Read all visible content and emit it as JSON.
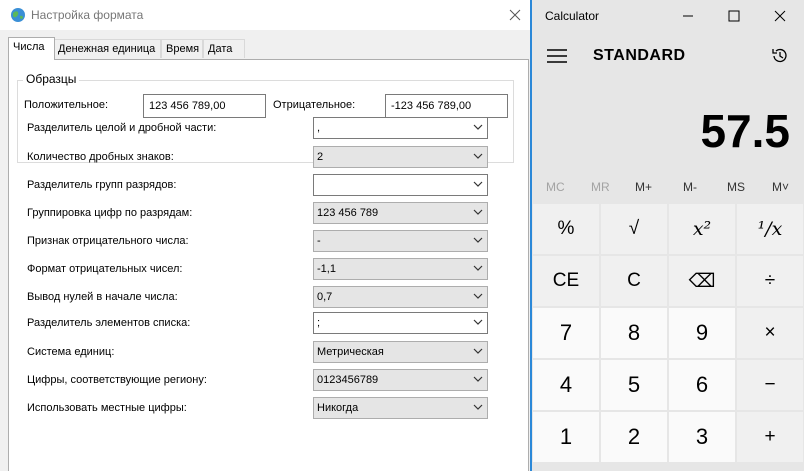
{
  "dialog": {
    "title": "Настройка формата",
    "tabs": [
      "Числа",
      "Денежная единица",
      "Время",
      "Дата"
    ],
    "samples": {
      "group_label": "Образцы",
      "positive_label": "Положительное:",
      "positive_value": "123 456 789,00",
      "negative_label": "Отрицательное:",
      "negative_value": "-123 456 789,00"
    },
    "settings": [
      {
        "label": "Разделитель целой и дробной части:",
        "value": ","
      },
      {
        "label": "Количество дробных знаков:",
        "value": "2"
      },
      {
        "label": "Разделитель групп разрядов:",
        "value": ""
      },
      {
        "label": "Группировка цифр по разрядам:",
        "value": "123 456 789"
      },
      {
        "label": "Признак отрицательного числа:",
        "value": "-"
      },
      {
        "label": "Формат отрицательных чисел:",
        "value": "-1,1"
      },
      {
        "label": "Вывод нулей в начале числа:",
        "value": "0,7"
      },
      {
        "label": "Разделитель элементов списка:",
        "value": ";"
      },
      {
        "label": "Система единиц:",
        "value": "Метрическая"
      },
      {
        "label": "Цифры, соответствующие региону:",
        "value": "0123456789"
      },
      {
        "label": "Использовать местные цифры:",
        "value": "Никогда"
      }
    ]
  },
  "calculator": {
    "title": "Calculator",
    "mode": "STANDARD",
    "display": "57.5",
    "memory": [
      "MC",
      "MR",
      "M+",
      "M-",
      "MS",
      "M˅"
    ],
    "keys": {
      "percent": "%",
      "sqrt": "√",
      "xsq": "x²",
      "recip": "¹/x",
      "ce": "CE",
      "c": "C",
      "backspace": "⌫",
      "divide": "÷",
      "n7": "7",
      "n8": "8",
      "n9": "9",
      "multiply": "×",
      "n4": "4",
      "n5": "5",
      "n6": "6",
      "minus": "−",
      "n1": "1",
      "n2": "2",
      "n3": "3",
      "plus": "+"
    },
    "colors": {
      "accent": "#2b88d8",
      "background": "#e6e6e6"
    }
  }
}
